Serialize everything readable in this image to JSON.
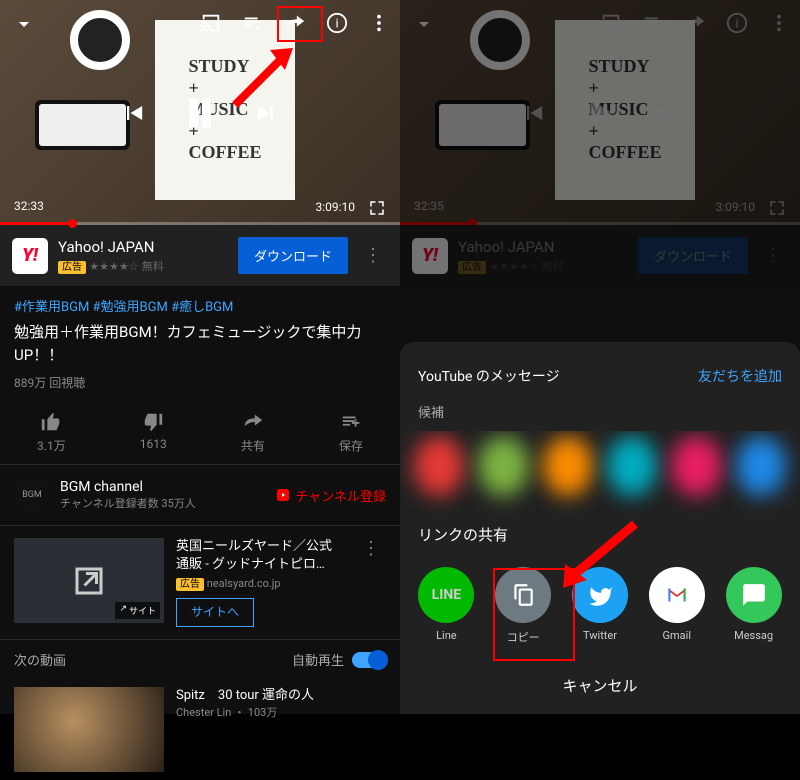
{
  "video": {
    "overlay": "STUDY + MUSIC + COFFEE"
  },
  "left": {
    "time_current": "32:33",
    "time_total": "3:09:10"
  },
  "right": {
    "time_current": "32:35",
    "time_total": "3:09:10"
  },
  "ad": {
    "brand": "Yahoo! JAPAN",
    "tag": "広告",
    "rating": "★★★★☆",
    "price": "無料",
    "cta": "ダウンロード"
  },
  "hashtags": "#作業用BGM #勉強用BGM #癒しBGM",
  "title": "勉強用＋作業用BGM！カフェミュージックで集中力UP！！",
  "views": "889万 回視聴",
  "actions": {
    "like": "3.1万",
    "dislike": "1613",
    "share": "共有",
    "save": "保存"
  },
  "channel": {
    "name": "BGM channel",
    "subs": "チャンネル登録者数 35万人",
    "btn": "チャンネル登録",
    "avatar": "BGM"
  },
  "promo": {
    "title": "英国ニールズヤード／公式通販 - グッドナイトピロ…",
    "tag": "広告",
    "domain": "nealsyard.co.jp",
    "cta": "サイトへ",
    "badge": "サイト"
  },
  "next": {
    "label": "次の動画",
    "autoplay": "自動再生"
  },
  "rec": {
    "title": "Spitz　30 tour 運命の人",
    "channel": "Chester Lin",
    "views": "103万"
  },
  "sheet": {
    "msg_header": "YouTube のメッセージ",
    "add_friend": "友だちを追加",
    "suggest": "候補",
    "link_header": "リンクの共有",
    "cancel": "キャンセル",
    "items": {
      "line": "Line",
      "copy": "コピー",
      "twitter": "Twitter",
      "gmail": "Gmail",
      "message": "Messag"
    }
  }
}
